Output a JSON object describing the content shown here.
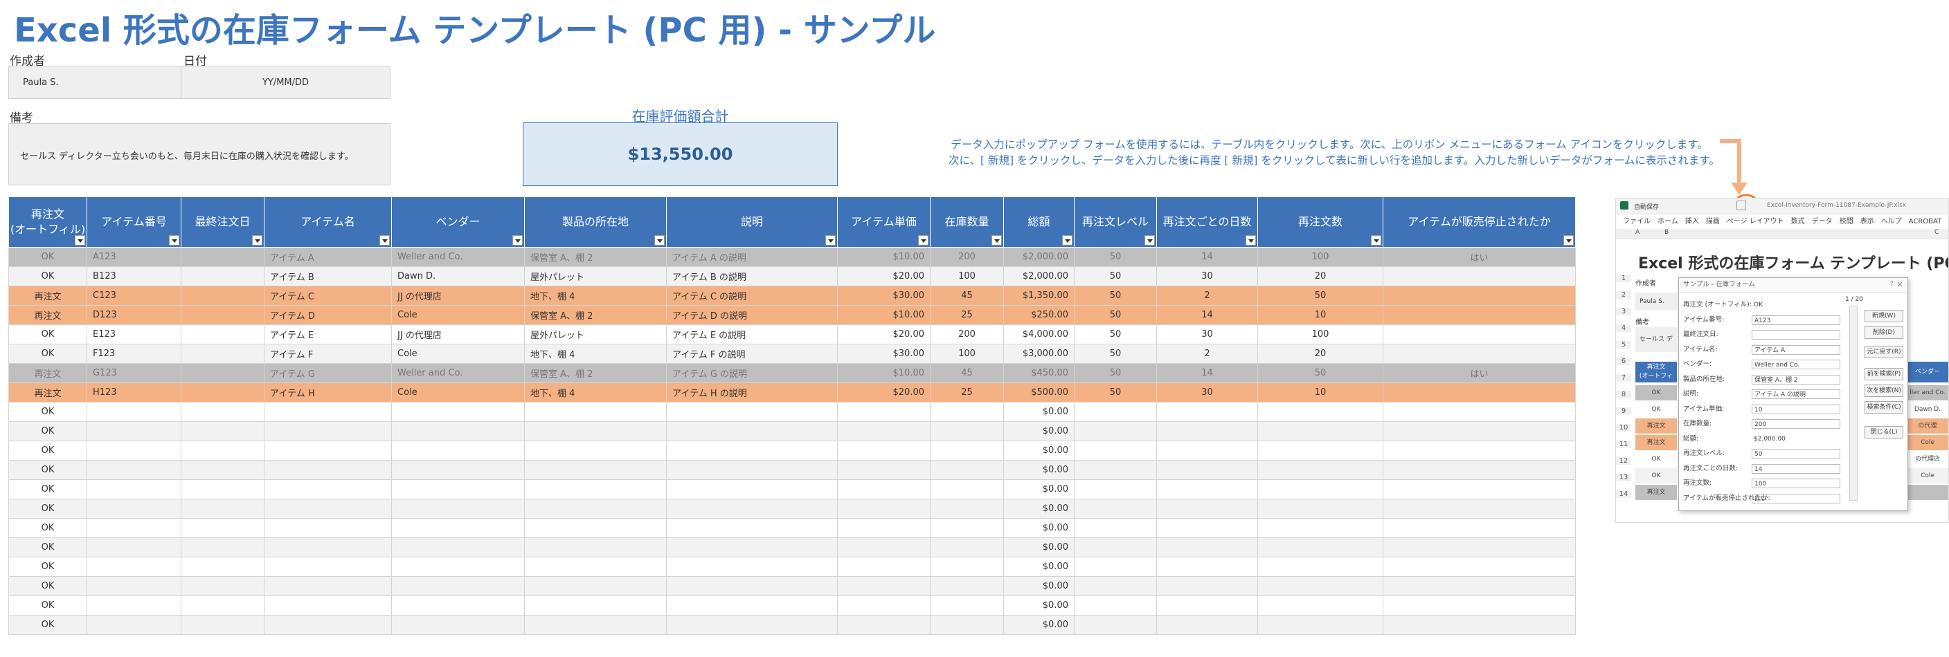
{
  "title": "Excel 形式の在庫フォーム テンプレート (PC 用) - サンプル",
  "author": {
    "label": "作成者",
    "value": "Paula S."
  },
  "date": {
    "label": "日付",
    "value": "YY/MM/DD"
  },
  "notes": {
    "label": "備考",
    "value": "セールス ディレクター立ち会いのもと、毎月末日に在庫の購入状況を確認します。"
  },
  "inventory_total": {
    "label": "在庫評価額合計",
    "value": "$13,550.00"
  },
  "instructions": {
    "line1": "データ入力にポップアップ フォームを使用するには、テーブル内をクリックします。次に、上のリボン メニューにあるフォーム アイコンをクリックします。",
    "line2": "次に、[ 新規] をクリックし、データを入力した後に再度 [ 新規] をクリックして表に新しい行を追加します。入力した新しいデータがフォームに表示されます。"
  },
  "colors": {
    "title": "#3d76bf",
    "header": "#3e73b8",
    "reorder": "#f4b183",
    "discontinued": "#bfbfbf",
    "accent_circle": "#ed7d31"
  },
  "table": {
    "columns": [
      "再注文\n(オートフィル)",
      "アイテム番号",
      "最終注文日",
      "アイテム名",
      "ベンダー",
      "製品の所在地",
      "説明",
      "アイテム単価",
      "在庫数量",
      "総額",
      "再注文レベル",
      "再注文ごとの日数",
      "再注文数",
      "アイテムが販売停止されたか"
    ],
    "rows": [
      {
        "status": "disc",
        "cells": [
          "OK",
          "A123",
          "",
          "アイテム A",
          "Weller and Co.",
          "保管室 A、棚 2",
          "アイテム A の説明",
          "$10.00",
          "200",
          "$2,000.00",
          "50",
          "14",
          "100",
          "はい"
        ]
      },
      {
        "status": "norm",
        "cells": [
          "OK",
          "B123",
          "",
          "アイテム B",
          "Dawn D.",
          "屋外パレット",
          "アイテム B の説明",
          "$20.00",
          "100",
          "$2,000.00",
          "50",
          "30",
          "20",
          ""
        ]
      },
      {
        "status": "reorder",
        "cells": [
          "再注文",
          "C123",
          "",
          "アイテム C",
          "JJ の代理店",
          "地下、棚 4",
          "アイテム C の説明",
          "$30.00",
          "45",
          "$1,350.00",
          "50",
          "2",
          "50",
          ""
        ]
      },
      {
        "status": "reorder",
        "cells": [
          "再注文",
          "D123",
          "",
          "アイテム D",
          "Cole",
          "保管室 A、棚 2",
          "アイテム D の説明",
          "$10.00",
          "25",
          "$250.00",
          "50",
          "14",
          "10",
          ""
        ]
      },
      {
        "status": "norm",
        "cells": [
          "OK",
          "E123",
          "",
          "アイテム E",
          "JJ の代理店",
          "屋外パレット",
          "アイテム E の説明",
          "$20.00",
          "200",
          "$4,000.00",
          "50",
          "30",
          "100",
          ""
        ]
      },
      {
        "status": "norm",
        "cells": [
          "OK",
          "F123",
          "",
          "アイテム F",
          "Cole",
          "地下、棚 4",
          "アイテム F の説明",
          "$30.00",
          "100",
          "$3,000.00",
          "50",
          "2",
          "20",
          ""
        ]
      },
      {
        "status": "disc",
        "cells": [
          "再注文",
          "G123",
          "",
          "アイテム G",
          "Weller and Co.",
          "保管室 A、棚 2",
          "アイテム G の説明",
          "$10.00",
          "45",
          "$450.00",
          "50",
          "14",
          "50",
          "はい"
        ]
      },
      {
        "status": "reorder",
        "cells": [
          "再注文",
          "H123",
          "",
          "アイテム H",
          "Cole",
          "地下、棚 4",
          "アイテム H の説明",
          "$20.00",
          "25",
          "$500.00",
          "50",
          "30",
          "10",
          ""
        ]
      }
    ],
    "empty_row": {
      "status_text": "OK",
      "total": "$0.00"
    },
    "empty_row_count": 12
  },
  "screenshot": {
    "title": "Excel 形式の在庫フォーム テンプレート (PC 用)",
    "autosave": "自動保存",
    "filename": "Excel-Inventory-Form-11087-Example-JP.xlsx",
    "ribbon_tabs": [
      "ファイル",
      "ホーム",
      "挿入",
      "描画",
      "ページ レイアウト",
      "数式",
      "データ",
      "校閲",
      "表示",
      "ヘルプ",
      "ACROBAT"
    ],
    "cols": [
      "A",
      "B",
      "C"
    ],
    "left_labels": [
      "作成者",
      "Paula S.",
      "備考",
      "セールス ディ"
    ],
    "header_left": "再注文\n(オートフィ",
    "header_right": "ベンダー",
    "left_cells": [
      "OK",
      "OK",
      "再注文",
      "再注文",
      "OK",
      "OK",
      "再注文"
    ],
    "right_cells": [
      "ller and Co.",
      "Dawn D.",
      "の代理",
      "Cole",
      "の代理店",
      "Cole",
      ""
    ],
    "row_numbers": [
      "1",
      "2",
      "3",
      "4",
      "5",
      "6",
      "7",
      "8",
      "9",
      "10",
      "11",
      "12",
      "13",
      "14"
    ],
    "dialog": {
      "title": "サンプル - 在庫フォーム",
      "counter": "1 / 20",
      "fields": [
        {
          "label": "再注文 (オートフィル):",
          "value": "OK",
          "input": false
        },
        {
          "label": "アイテム番号:",
          "value": "A123",
          "input": true
        },
        {
          "label": "最終注文日:",
          "value": "",
          "input": true
        },
        {
          "label": "アイテム名:",
          "value": "アイテム A",
          "input": true
        },
        {
          "label": "ベンダー:",
          "value": "Weller and Co.",
          "input": true
        },
        {
          "label": "製品の所在地:",
          "value": "保管室 A、棚 2",
          "input": true
        },
        {
          "label": "説明:",
          "value": "アイテム A の説明",
          "input": true
        },
        {
          "label": "アイテム単価:",
          "value": "10",
          "input": true
        },
        {
          "label": "在庫数量:",
          "value": "200",
          "input": true
        },
        {
          "label": "総額:",
          "value": "$2,000.00",
          "input": false
        },
        {
          "label": "再注文レベル:",
          "value": "50",
          "input": true
        },
        {
          "label": "再注文ごとの日数:",
          "value": "14",
          "input": true
        },
        {
          "label": "再注文数:",
          "value": "100",
          "input": true
        },
        {
          "label": "アイテムが販売停止されたか:",
          "value": "はい",
          "input": true
        }
      ],
      "buttons": [
        "新規(W)",
        "削除(D)",
        "元に戻す(R)",
        "前を検索(P)",
        "次を検索(N)",
        "検索条件(C)",
        "閉じる(L)"
      ]
    }
  }
}
